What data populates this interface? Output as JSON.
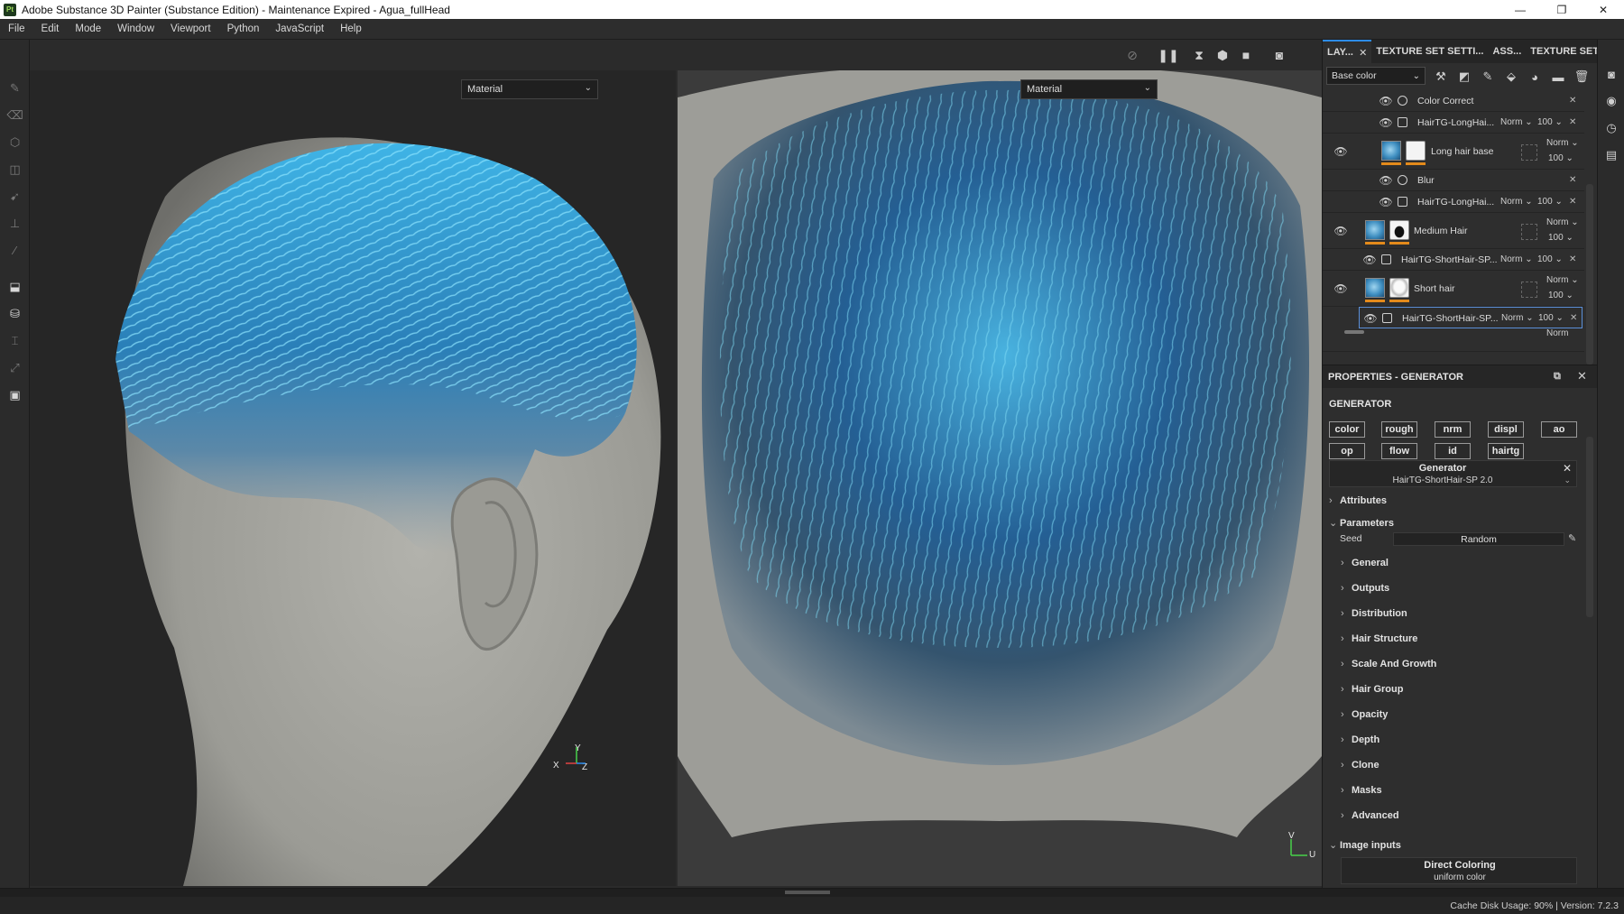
{
  "window": {
    "title": "Adobe Substance 3D Painter (Substance Edition) - Maintenance Expired - Agua_fullHead",
    "logo": "Pt",
    "minimize": "—",
    "maximize": "❐",
    "close": "✕"
  },
  "menu": [
    "File",
    "Edit",
    "Mode",
    "Window",
    "Viewport",
    "Python",
    "JavaScript",
    "Help"
  ],
  "viewport3d": {
    "display_mode": "Material",
    "axis_y": "Y",
    "axis_x": "X",
    "axis_z": "Z"
  },
  "viewport2d": {
    "display_mode": "Material",
    "axis_v": "V",
    "axis_u": "U"
  },
  "tabs": [
    "LAY...",
    "TEXTURE SET SETTI...",
    "ASS...",
    "TEXTURE SET L..."
  ],
  "tab_close": "✕",
  "layers": {
    "channel": "Base color",
    "rows": [
      {
        "name": "Color Correct",
        "type": "filter"
      },
      {
        "name": "HairTG-LongHai...",
        "type": "fill",
        "blend": "Norm",
        "opacity": "100"
      },
      {
        "name": "Long hair base",
        "type": "group",
        "blend": "Norm",
        "opacity": "100"
      },
      {
        "name": "Blur",
        "type": "filter"
      },
      {
        "name": "HairTG-LongHai...",
        "type": "fill",
        "blend": "Norm",
        "opacity": "100"
      },
      {
        "name": "Medium Hair",
        "type": "group",
        "blend": "Norm",
        "opacity": "100"
      },
      {
        "name": "HairTG-ShortHair-SP...",
        "type": "fill",
        "blend": "Norm",
        "opacity": "100"
      },
      {
        "name": "Short hair",
        "type": "group",
        "blend": "Norm",
        "opacity": "100"
      },
      {
        "name": "HairTG-ShortHair-SP...",
        "type": "fill",
        "blend": "Norm",
        "opacity": "100"
      },
      {
        "name": "",
        "type": "partial",
        "blend": "Norm"
      }
    ]
  },
  "properties": {
    "header": "PROPERTIES - GENERATOR",
    "section": "GENERATOR",
    "channels": [
      "color",
      "rough",
      "nrm",
      "displ",
      "ao",
      "op",
      "flow",
      "id",
      "hairtg"
    ],
    "generator_title": "Generator",
    "generator_name": "HairTG-ShortHair-SP 2.0",
    "attributes": "Attributes",
    "parameters": "Parameters",
    "seed_label": "Seed",
    "seed_value": "Random",
    "groups": [
      "General",
      "Outputs",
      "Distribution",
      "Hair Structure",
      "Scale And Growth",
      "Hair Group",
      "Opacity",
      "Depth",
      "Clone",
      "Masks",
      "Advanced"
    ],
    "image_inputs": "Image inputs",
    "direct_coloring": "Direct Coloring",
    "direct_coloring_value": "uniform color"
  },
  "status": "Cache Disk Usage:   90% | Version: 7.2.3",
  "colors": {
    "accent": "#2d8ceb",
    "hair_light": "#5fd2f0",
    "hair_dark": "#1b4f7a",
    "skin": "#a8a8a2"
  }
}
